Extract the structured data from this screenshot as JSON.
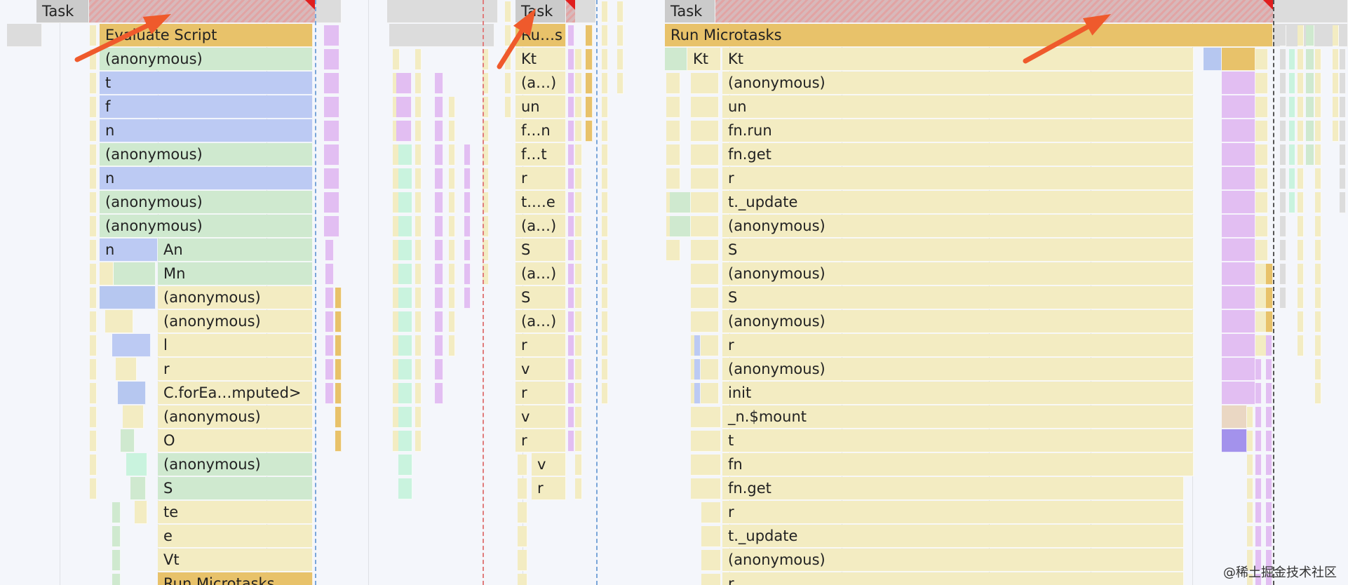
{
  "col1": {
    "task": "Task",
    "rows": [
      "Evaluate Script",
      "(anonymous)",
      "t",
      "f",
      "n",
      "(anonymous)",
      "n",
      "(anonymous)",
      "(anonymous)"
    ],
    "split_row": {
      "left": "n",
      "right": "An"
    },
    "inner": [
      "Mn",
      "(anonymous)",
      "(anonymous)",
      "l",
      "r",
      "C.forEa…mputed>",
      "(anonymous)",
      "O",
      "(anonymous)",
      "S",
      "te",
      "e",
      "Vt",
      "Run Microtasks"
    ]
  },
  "col2": {
    "task": "Task",
    "rows": [
      "Ru…s",
      "Kt",
      "(a…)",
      "un",
      "f…n",
      "f…t",
      "r",
      "t.…e",
      "(a…)",
      "S",
      "(a…)",
      "S",
      "(a…)",
      "r",
      "v",
      "r",
      "v",
      "r"
    ],
    "deep": [
      "v",
      "r"
    ]
  },
  "col3": {
    "task": "Task",
    "run": "Run Microtasks",
    "kt_left": "Kt",
    "rows": [
      "Kt",
      "(anonymous)",
      "un",
      "fn.run",
      "fn.get",
      "r",
      "t._update",
      "(anonymous)",
      "S",
      "(anonymous)",
      "S",
      "(anonymous)",
      "r",
      "(anonymous)",
      "init",
      "_n.$mount",
      "t",
      "fn",
      "fn.get",
      "r",
      "t._update",
      "(anonymous)",
      "r"
    ]
  },
  "watermark": "@稀土掘金技术社区",
  "colors": {
    "task": "#cbcbcb",
    "script_yellow": "#e8c26a",
    "light_green": "#cfe9cf",
    "blue": "#bccaf3",
    "light_yellow": "#f3ecc2",
    "purple": "#e2bef2",
    "arrow": "#ef5a2c",
    "long_task_mark": "#e01e1e"
  }
}
